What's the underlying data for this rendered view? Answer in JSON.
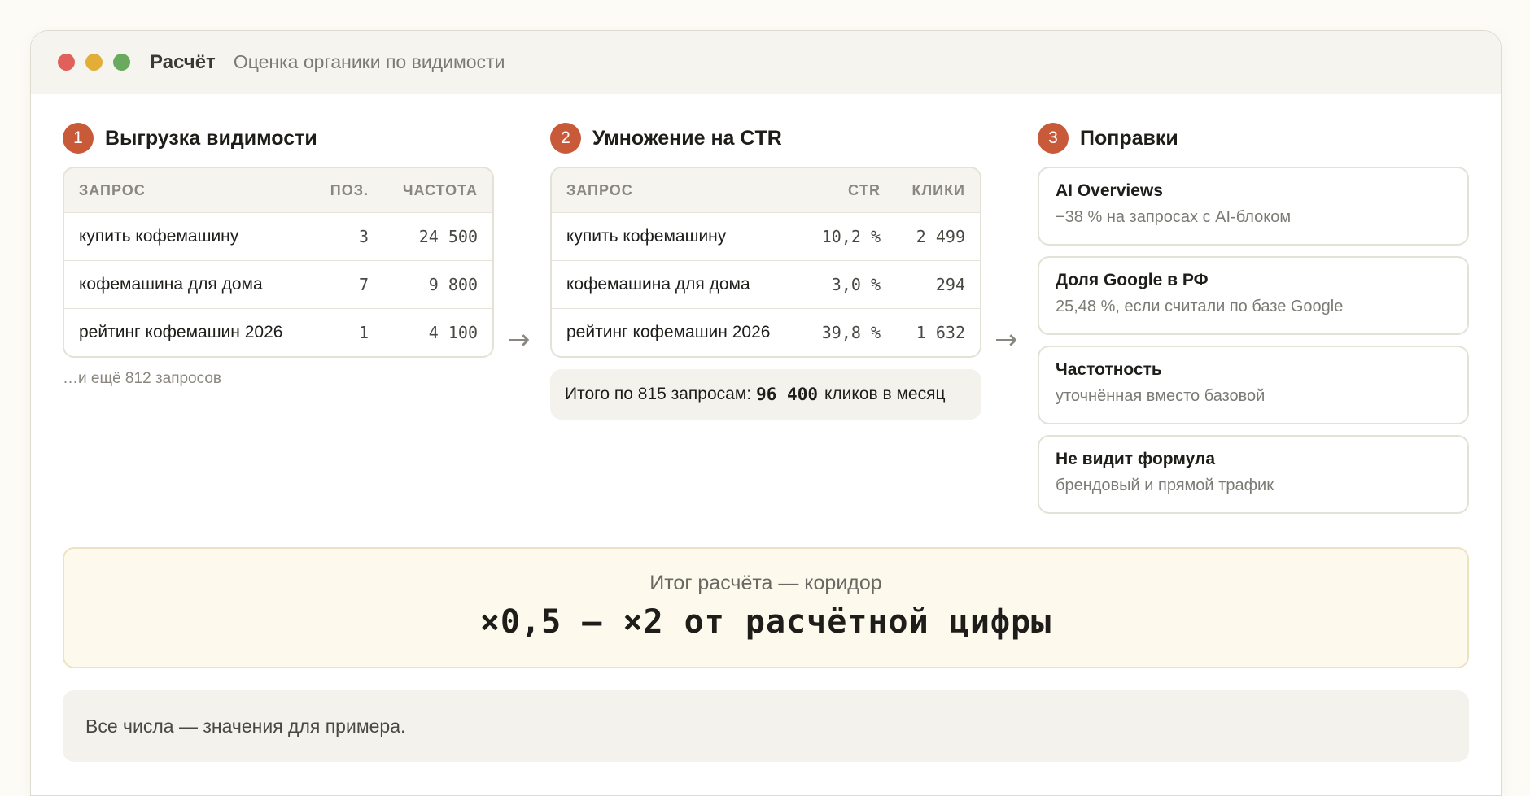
{
  "window": {
    "title": "Расчёт",
    "subtitle": "Оценка органики по видимости"
  },
  "step1": {
    "num": "1",
    "title": "Выгрузка видимости",
    "headers": [
      "ЗАПРОС",
      "ПОЗ.",
      "ЧАСТОТА"
    ],
    "rows": [
      [
        "купить кофемашину",
        "3",
        "24 500"
      ],
      [
        "кофемашина для дома",
        "7",
        "9 800"
      ],
      [
        "рейтинг кофемашин 2026",
        "1",
        "4 100"
      ]
    ],
    "more": "…и ещё 812 запросов"
  },
  "step2": {
    "num": "2",
    "title": "Умножение на CTR",
    "headers": [
      "ЗАПРОС",
      "CTR",
      "КЛИКИ"
    ],
    "rows": [
      [
        "купить кофемашину",
        "10,2 %",
        "2 499"
      ],
      [
        "кофемашина для дома",
        "3,0 %",
        "294"
      ],
      [
        "рейтинг кофемашин 2026",
        "39,8 %",
        "1 632"
      ]
    ],
    "total_prefix": "Итого по 815 запросам:",
    "total_value": "96 400",
    "total_suffix": "кликов в месяц"
  },
  "step3": {
    "num": "3",
    "title": "Поправки",
    "cards": [
      {
        "title": "AI Overviews",
        "text": "−38 % на запросах с AI-блоком"
      },
      {
        "title": "Доля Google в РФ",
        "text": "25,48 %, если считали по базе Google"
      },
      {
        "title": "Частотность",
        "text": "уточнённая вместо базовой"
      },
      {
        "title": "Не видит формула",
        "text": "брендовый и прямой трафик"
      }
    ]
  },
  "arrow_icon": "→",
  "result": {
    "label": "Итог расчёта — коридор",
    "value": "×0,5 — ×2 от расчётной цифры"
  },
  "note": "Все числа — значения для примера.",
  "colors": {
    "accent": "#c85a3a",
    "dot_red": "#e0605b",
    "dot_yellow": "#e2ae38",
    "dot_green": "#6aaa5e"
  }
}
